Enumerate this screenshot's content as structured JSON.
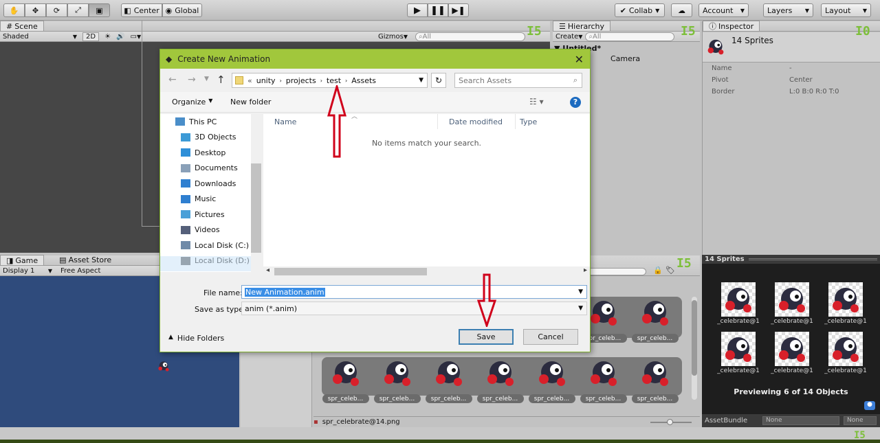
{
  "toolbar": {
    "pivot": "Center",
    "space": "Global",
    "collab": "Collab",
    "account": "Account",
    "layers": "Layers",
    "layout": "Layout"
  },
  "scene": {
    "tab": "Scene",
    "shading": "Shaded",
    "mode2d": "2D",
    "gizmos": "Gizmos",
    "search_placeholder": "All"
  },
  "game": {
    "tab": "Game",
    "asset_store_tab": "Asset Store",
    "display": "Display 1",
    "aspect": "Free Aspect"
  },
  "hierarchy": {
    "tab": "Hierarchy",
    "create": "Create",
    "search_placeholder": "All",
    "scene_name": "Untitled*",
    "item": "Camera"
  },
  "inspector": {
    "tab": "Inspector",
    "title": "14 Sprites",
    "rows": [
      {
        "label": "Name",
        "value": "-"
      },
      {
        "label": "Pivot",
        "value": "Center"
      },
      {
        "label": "Border",
        "value": "L:0 B:0 R:0 T:0"
      }
    ],
    "preview_title": "14 Sprites",
    "preview_labels": [
      "_celebrate@1",
      "_celebrate@1",
      "_celebrate@1",
      "_celebrate@1",
      "_celebrate@1",
      "_celebrate@1"
    ],
    "preview_caption": "Previewing 6 of 14 Objects",
    "assetbundle_label": "AssetBundle",
    "assetbundle_value": "None",
    "assetbundle_variant": "None"
  },
  "project": {
    "thumb_label": "spr_celeb...",
    "status_file": "spr_celebrate@14.png"
  },
  "dialog": {
    "title": "Create New Animation",
    "breadcrumb": [
      "unity",
      "projects",
      "test",
      "Assets"
    ],
    "search_placeholder": "Search Assets",
    "organize": "Organize",
    "new_folder": "New folder",
    "tree": [
      {
        "label": "This PC",
        "icon": "pc-icon",
        "color": "#4a8ec9"
      },
      {
        "label": "3D Objects",
        "icon": "cube-icon",
        "color": "#3d9ad6"
      },
      {
        "label": "Desktop",
        "icon": "desktop-icon",
        "color": "#2f8fd8"
      },
      {
        "label": "Documents",
        "icon": "document-icon",
        "color": "#8aa0b8"
      },
      {
        "label": "Downloads",
        "icon": "download-icon",
        "color": "#2f7fd0"
      },
      {
        "label": "Music",
        "icon": "music-icon",
        "color": "#2f7fd0"
      },
      {
        "label": "Pictures",
        "icon": "picture-icon",
        "color": "#4aa0d8"
      },
      {
        "label": "Videos",
        "icon": "video-icon",
        "color": "#55607a"
      },
      {
        "label": "Local Disk (C:)",
        "icon": "disk-icon",
        "color": "#6f8aa8"
      },
      {
        "label": "Local Disk (D:)",
        "icon": "disk-icon",
        "color": "#5a5a5a"
      }
    ],
    "columns": [
      "Name",
      "Date modified",
      "Type"
    ],
    "empty_text": "No items match your search.",
    "file_name_label": "File name:",
    "file_name_value": "New Animation.anim",
    "save_type_label": "Save as type:",
    "save_type_value": "anim (*.anim)",
    "hide_folders": "Hide Folders",
    "save": "Save",
    "cancel": "Cancel"
  },
  "colors": {
    "dialog_title_bg": "#a1c73c",
    "arrow": "#d0021b",
    "game_bg": "#2f4b7c"
  }
}
